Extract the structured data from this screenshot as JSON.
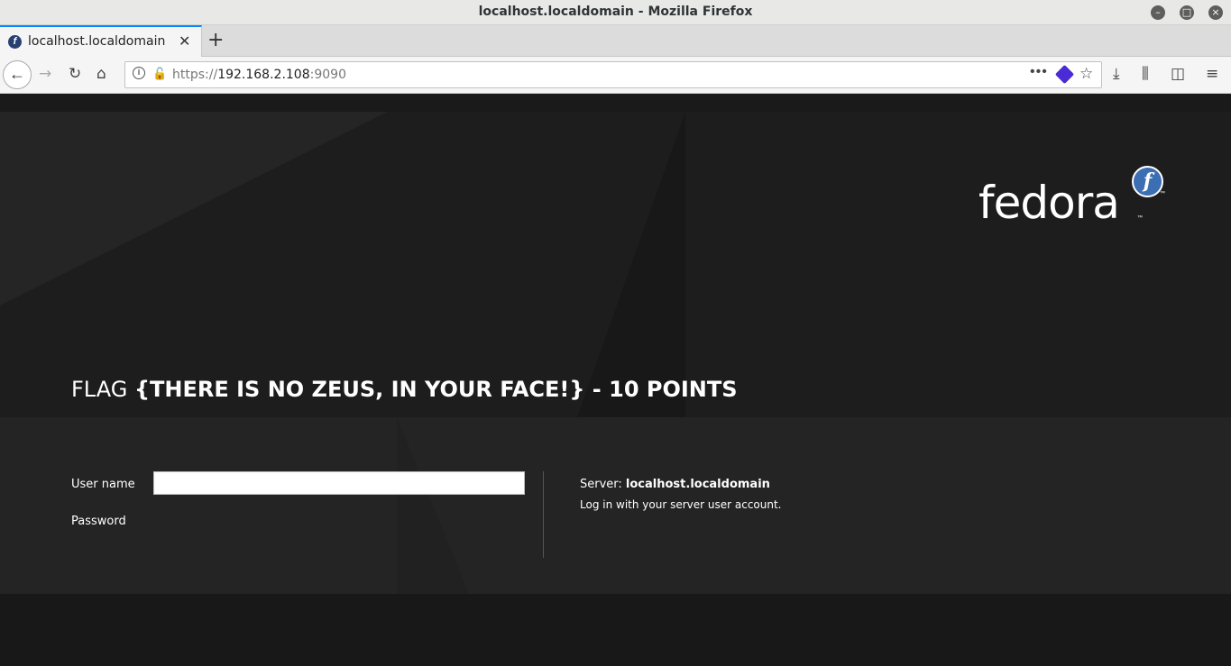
{
  "window": {
    "title": "localhost.localdomain - Mozilla Firefox",
    "minimize_icon": "minimize-icon",
    "maximize_icon": "maximize-icon",
    "close_icon": "close-icon"
  },
  "tabs": [
    {
      "label": "localhost.localdomain",
      "icon": "fedora-favicon",
      "active": true
    }
  ],
  "navbar": {
    "url_scheme": "https://",
    "url_host": "192.168.2.108",
    "url_port": ":9090",
    "back_icon": "back-arrow-icon",
    "forward_icon": "forward-arrow-icon",
    "reload_icon": "reload-icon",
    "home_icon": "home-icon"
  },
  "page": {
    "brand": "fedora",
    "brand_badge": "f",
    "trademark": "™",
    "flag_prefix": "FLAG ",
    "flag_text": "{THERE IS NO ZEUS, IN YOUR FACE!} - 10 POINTS",
    "username_label": "User name",
    "username_value": "",
    "password_label": "Password",
    "server_label": "Server: ",
    "server_name": "localhost.localdomain",
    "hint": "Log in with your server user account."
  },
  "colors": {
    "accent": "#0a84ff",
    "fedora_blue": "#3c6eb4",
    "page_background": "#1c1c1c",
    "form_band": "#242424"
  }
}
